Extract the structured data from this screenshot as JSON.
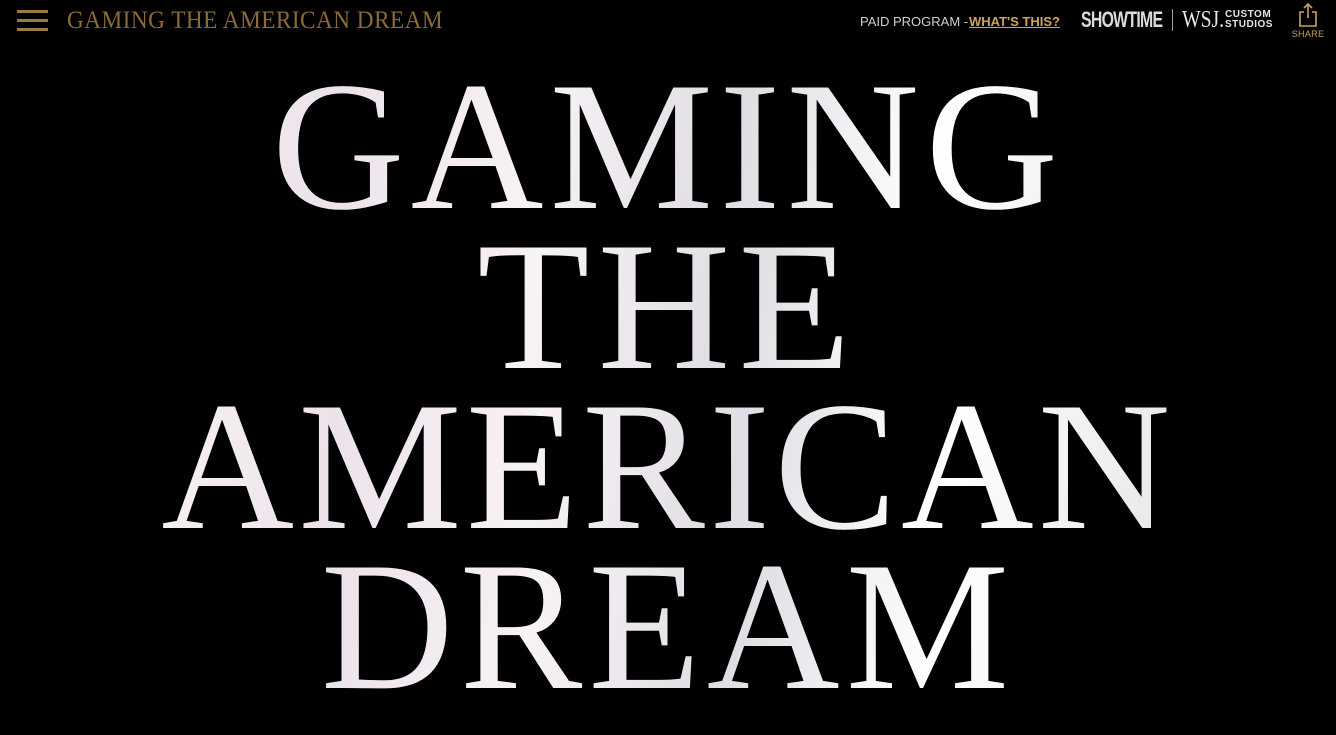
{
  "header": {
    "site_title": "GAMING THE AMERICAN DREAM",
    "paid_program": "PAID PROGRAM -",
    "whats_this": "WHAT'S THIS?",
    "sponsor_logo": "SHOWTIME",
    "publisher_logo": "WSJ.",
    "publisher_sub_1": "CUSTOM",
    "publisher_sub_2": "STUDIOS",
    "share_label": "SHARE",
    "icons": {
      "menu": "hamburger-menu-icon",
      "share": "share-icon"
    }
  },
  "hero": {
    "lines": [
      "GAMING",
      "THE",
      "AMERICAN",
      "DREAM"
    ]
  },
  "colors": {
    "background": "#000000",
    "gold": "#9a7a3e",
    "link_gold": "#c9a45c",
    "hero_text": "#f4f1f3"
  }
}
